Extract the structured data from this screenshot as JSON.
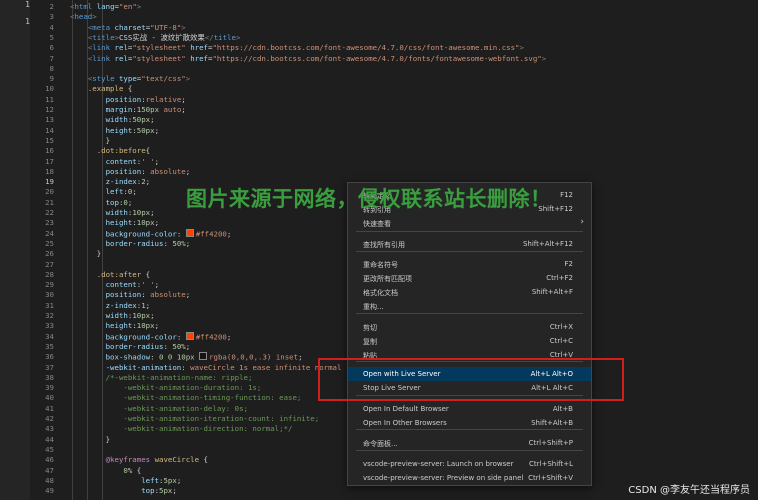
{
  "gutter_marks": [
    "1",
    "1"
  ],
  "code_lines": [
    {
      "n": "2",
      "html": "<span class='pun'>&lt;</span><span class='tag'>html</span> <span class='attr'>lang</span>=<span class='str'>\"en\"</span><span class='pun'>&gt;</span>"
    },
    {
      "n": "3",
      "html": "<span class='pun'>&lt;</span><span class='tag'>head</span><span class='pun'>&gt;</span>"
    },
    {
      "n": "4",
      "html": "    <span class='pun'>&lt;</span><span class='tag'>meta</span> <span class='attr'>charset</span>=<span class='str'>\"UTF-8\"</span><span class='pun'>&gt;</span>"
    },
    {
      "n": "5",
      "html": "    <span class='pun'>&lt;</span><span class='tag'>title</span><span class='pun'>&gt;</span>CSS实战 - 波纹扩散效果<span class='pun'>&lt;/</span><span class='tag'>title</span><span class='pun'>&gt;</span>"
    },
    {
      "n": "6",
      "html": "    <span class='pun'>&lt;</span><span class='tag'>link</span> <span class='attr'>rel</span>=<span class='str'>\"stylesheet\"</span> <span class='attr'>href</span>=<span class='str'>\"https://cdn.bootcss.com/font-awesome/4.7.0/css/font-awesome.min.css\"</span><span class='pun'>&gt;</span>"
    },
    {
      "n": "7",
      "html": "    <span class='pun'>&lt;</span><span class='tag'>link</span> <span class='attr'>rel</span>=<span class='str'>\"stylesheet\"</span> <span class='attr'>href</span>=<span class='str'>\"https://cdn.bootcss.com/font-awesome/4.7.0/fonts/fontawesome-webfont.svg\"</span><span class='pun'>&gt;</span>"
    },
    {
      "n": "8",
      "html": ""
    },
    {
      "n": "9",
      "html": "    <span class='pun'>&lt;</span><span class='tag'>style</span> <span class='attr'>type</span>=<span class='str'>\"text/css\"</span><span class='pun'>&gt;</span>"
    },
    {
      "n": "10",
      "html": "    <span class='sel'>.example</span> {"
    },
    {
      "n": "11",
      "html": "        <span class='prop'>position</span>:<span class='str'>relative</span>;"
    },
    {
      "n": "12",
      "html": "        <span class='prop'>margin</span>:<span class='val'>150px</span> <span class='str'>auto</span>;"
    },
    {
      "n": "13",
      "html": "        <span class='prop'>width</span>:<span class='val'>50px</span>;"
    },
    {
      "n": "14",
      "html": "        <span class='prop'>height</span>:<span class='val'>50px</span>;"
    },
    {
      "n": "15",
      "html": "        }"
    },
    {
      "n": "16",
      "html": "      <span class='sel'>.dot:before</span>{"
    },
    {
      "n": "17",
      "html": "        <span class='prop'>content</span>:<span class='str'>' '</span>;"
    },
    {
      "n": "18",
      "html": "        <span class='prop'>position</span>: <span class='str'>absolute</span>;"
    },
    {
      "n": "19",
      "html": "        <span class='prop'>z-index</span>:<span class='val'>2</span>;"
    },
    {
      "n": "20",
      "html": "        <span class='prop'>left</span>:<span class='val'>0</span>;"
    },
    {
      "n": "21",
      "html": "        <span class='prop'>top</span>:<span class='val'>0</span>;"
    },
    {
      "n": "22",
      "html": "        <span class='prop'>width</span>:<span class='val'>10px</span>;"
    },
    {
      "n": "23",
      "html": "        <span class='prop'>height</span>:<span class='val'>10px</span>;"
    },
    {
      "n": "24",
      "html": "        <span class='prop'>background-color</span>: <span class='sw' style='background:#ff4200'></span><span class='str'>#ff4200</span>;"
    },
    {
      "n": "25",
      "html": "        <span class='prop'>border-radius</span>: <span class='val'>50%</span>;"
    },
    {
      "n": "26",
      "html": "      }"
    },
    {
      "n": "27",
      "html": ""
    },
    {
      "n": "28",
      "html": "      <span class='sel'>.dot:after</span> {"
    },
    {
      "n": "29",
      "html": "        <span class='prop'>content</span>:<span class='str'>' '</span>;"
    },
    {
      "n": "30",
      "html": "        <span class='prop'>position</span>: <span class='str'>absolute</span>;"
    },
    {
      "n": "31",
      "html": "        <span class='prop'>z-index</span>:<span class='val'>1</span>;"
    },
    {
      "n": "32",
      "html": "        <span class='prop'>width</span>:<span class='val'>10px</span>;"
    },
    {
      "n": "33",
      "html": "        <span class='prop'>height</span>:<span class='val'>10px</span>;"
    },
    {
      "n": "34",
      "html": "        <span class='prop'>background-color</span>: <span class='sw' style='background:#ff4200'></span><span class='str'>#ff4200</span>;"
    },
    {
      "n": "35",
      "html": "        <span class='prop'>border-radius</span>: <span class='val'>50%</span>;"
    },
    {
      "n": "36",
      "html": "        <span class='prop'>box-shadow</span>: <span class='val'>0 0 10px</span> <span class='sw' style='background:rgba(0,0,0,.3)'></span><span class='str'>rgba(0,0,0,.3)</span> <span class='str'>inset</span>;"
    },
    {
      "n": "37",
      "html": "        <span class='prop'>-webkit-animation</span>: <span class='str'>waveCircle 1s ease infinite normal</span> ;"
    },
    {
      "n": "38",
      "html": "        <span class='com'>/*-webkit-animation-name: ripple;</span>"
    },
    {
      "n": "39",
      "html": "<span class='com'>            -webkit-animation-duration: 1s;</span>"
    },
    {
      "n": "40",
      "html": "<span class='com'>            -webkit-animation-timing-function: ease;</span>"
    },
    {
      "n": "41",
      "html": "<span class='com'>            -webkit-animation-delay: 0s;</span>"
    },
    {
      "n": "42",
      "html": "<span class='com'>            -webkit-animation-iteration-count: infinite;</span>"
    },
    {
      "n": "43",
      "html": "<span class='com'>            -webkit-animation-direction: normal;*/</span>"
    },
    {
      "n": "44",
      "html": "        }"
    },
    {
      "n": "45",
      "html": ""
    },
    {
      "n": "46",
      "html": "        <span class='at'>@keyframes</span> <span class='sel'>waveCircle</span> {"
    },
    {
      "n": "47",
      "html": "            <span class='val'>0%</span> {"
    },
    {
      "n": "48",
      "html": "                <span class='prop'>left</span>:<span class='val'>5px</span>;"
    },
    {
      "n": "49",
      "html": "                <span class='prop'>top</span>:<span class='val'>5px</span>;"
    }
  ],
  "watermark": "图片来源于网络，侵权联系站长删除！",
  "context_menu": [
    {
      "label": "转到定义",
      "shortcut": "F12"
    },
    {
      "label": "转到引用",
      "shortcut": "Shift+F12"
    },
    {
      "label": "快速查看",
      "shortcut": "",
      "submenu": true
    },
    {
      "label": "查找所有引用",
      "shortcut": "Shift+Alt+F12"
    },
    {
      "label": "重命名符号",
      "shortcut": "F2"
    },
    {
      "label": "更改所有匹配项",
      "shortcut": "Ctrl+F2"
    },
    {
      "label": "格式化文档",
      "shortcut": "Shift+Alt+F"
    },
    {
      "label": "重构...",
      "shortcut": ""
    },
    {
      "label": "剪切",
      "shortcut": "Ctrl+X"
    },
    {
      "label": "复制",
      "shortcut": "Ctrl+C"
    },
    {
      "label": "粘贴",
      "shortcut": "Ctrl+V"
    },
    {
      "label": "Open with Live Server",
      "shortcut": "Alt+L Alt+O",
      "active": true
    },
    {
      "label": "Stop Live Server",
      "shortcut": "Alt+L Alt+C"
    },
    {
      "label": "Open In Default Browser",
      "shortcut": "Alt+B"
    },
    {
      "label": "Open In Other Browsers",
      "shortcut": "Shift+Alt+B"
    },
    {
      "label": "命令面板...",
      "shortcut": "Ctrl+Shift+P"
    },
    {
      "label": "vscode-preview-server: Launch on browser",
      "shortcut": "Ctrl+Shift+L"
    },
    {
      "label": "vscode-preview-server: Preview on side panel",
      "shortcut": "Ctrl+Shift+V"
    }
  ],
  "credit": "CSDN @李友午还当程序员"
}
